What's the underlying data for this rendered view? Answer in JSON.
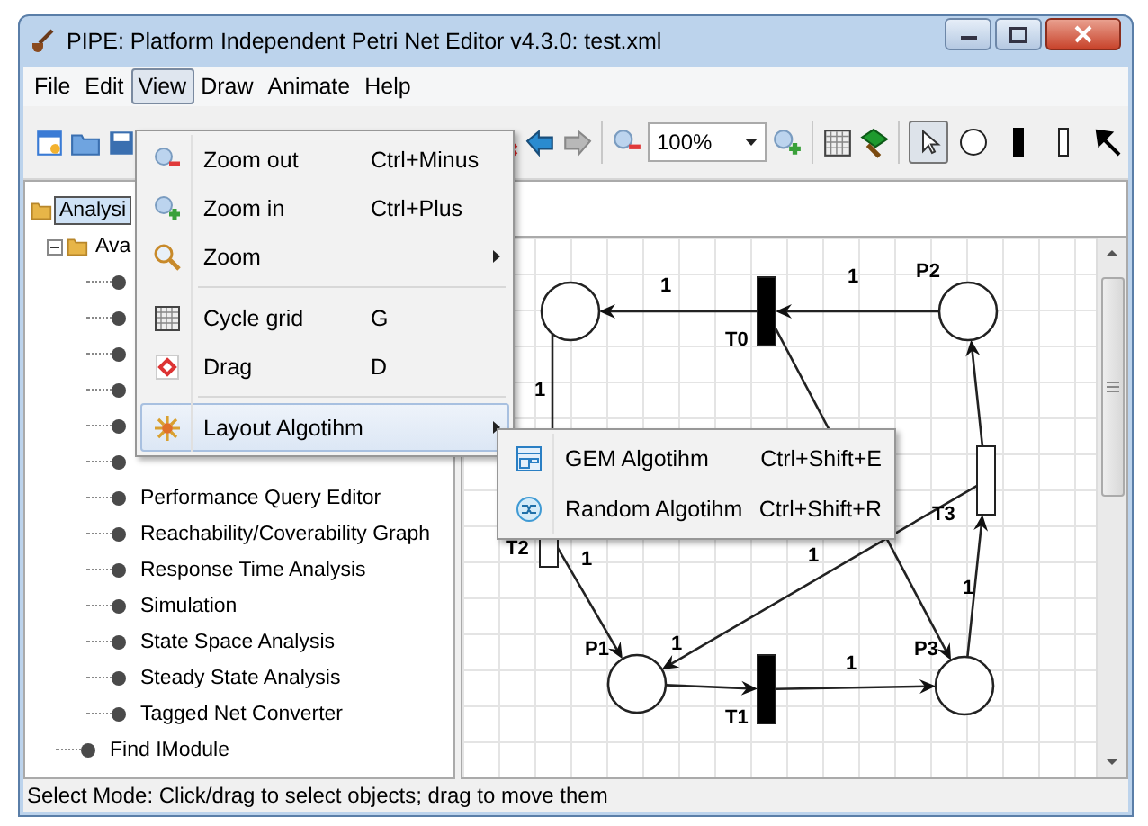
{
  "window": {
    "title": "PIPE: Platform Independent Petri Net Editor v4.3.0: test.xml"
  },
  "menubar": [
    {
      "label": "File",
      "selected": false
    },
    {
      "label": "Edit",
      "selected": false
    },
    {
      "label": "View",
      "selected": true
    },
    {
      "label": "Draw",
      "selected": false
    },
    {
      "label": "Animate",
      "selected": false
    },
    {
      "label": "Help",
      "selected": false
    }
  ],
  "toolbar": {
    "zoom": "100%",
    "mode_tools": [
      {
        "selected": true
      },
      {
        "selected": false
      },
      {
        "selected": false
      },
      {
        "selected": false
      },
      {
        "selected": false
      }
    ]
  },
  "tree": {
    "label": "Analysi",
    "selected": true,
    "children": [
      {
        "label": "Ava",
        "selected": false,
        "expanded": true,
        "children": [
          {
            "selected": false
          },
          {
            "selected": false
          },
          {
            "selected": false
          },
          {
            "selected": false
          },
          {
            "selected": false
          },
          {
            "selected": false
          },
          {
            "label": "Performance Query Editor",
            "selected": false
          },
          {
            "label": "Reachability/Coverability Graph",
            "selected": false
          },
          {
            "label": "Response Time Analysis",
            "selected": false
          },
          {
            "label": "Simulation",
            "selected": false
          },
          {
            "label": "State Space Analysis",
            "selected": false
          },
          {
            "label": "Steady State Analysis",
            "selected": false
          },
          {
            "label": "Tagged Net Converter",
            "selected": false
          }
        ]
      },
      {
        "label": "Find IModule",
        "selected": false
      }
    ]
  },
  "net": {
    "place_labels": [
      "P1",
      "P2",
      "P3"
    ],
    "transitions": [
      {
        "label": "T0",
        "kind": "immediate"
      },
      {
        "label": "T1",
        "kind": "immediate"
      },
      {
        "label": "T2",
        "kind": "timed"
      },
      {
        "label": "T3",
        "kind": "timed"
      }
    ],
    "arc_weights": [
      "1",
      "1",
      "1",
      "1",
      "1",
      "1",
      "1",
      "1"
    ]
  },
  "view_menu": [
    {
      "kind": "item",
      "label": "Zoom out",
      "shortcut": "Ctrl+Minus",
      "selected": false
    },
    {
      "kind": "item",
      "label": "Zoom in",
      "shortcut": "Ctrl+Plus",
      "selected": false
    },
    {
      "kind": "submenu",
      "label": "Zoom",
      "selected": false
    },
    {
      "kind": "separator"
    },
    {
      "kind": "item",
      "label": "Cycle grid",
      "shortcut": "G",
      "selected": false
    },
    {
      "kind": "item",
      "label": "Drag",
      "shortcut": "D",
      "selected": false
    },
    {
      "kind": "separator"
    },
    {
      "kind": "submenu",
      "label": "Layout Algotihm",
      "selected": true
    }
  ],
  "layout_submenu": [
    {
      "label": "GEM Algotihm",
      "shortcut": "Ctrl+Shift+E"
    },
    {
      "label": "Random Algotihm",
      "shortcut": "Ctrl+Shift+R"
    }
  ],
  "status_bar": "Select Mode: Click/drag to select objects; drag to move them"
}
